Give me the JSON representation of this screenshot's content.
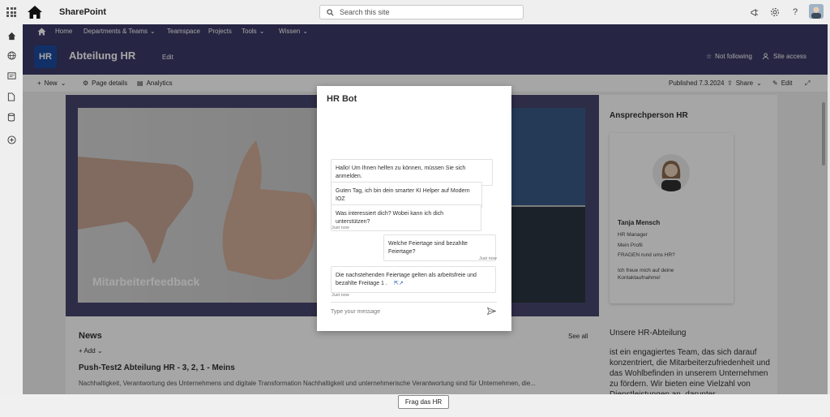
{
  "suite": {
    "app_title": "SharePoint",
    "search_placeholder": "Search this site"
  },
  "site_nav": {
    "items": [
      {
        "label": "Home",
        "dropdown": false
      },
      {
        "label": "Departments & Teams",
        "dropdown": true
      },
      {
        "label": "Teamspace",
        "dropdown": false
      },
      {
        "label": "Projects",
        "dropdown": false
      },
      {
        "label": "Tools",
        "dropdown": true
      },
      {
        "label": "Wissen",
        "dropdown": true
      }
    ]
  },
  "site_header": {
    "logo_text": "HR",
    "title": "Abteilung HR",
    "edit_label": "Edit",
    "follow_label": "Not following",
    "access_label": "Site access"
  },
  "command_bar": {
    "new_label": "New",
    "page_details_label": "Page details",
    "analytics_label": "Analytics",
    "published_label": "Published 7.3.2024",
    "share_label": "Share",
    "edit_label": "Edit"
  },
  "hero": {
    "caption": "Mitarbeiterfeedback"
  },
  "news": {
    "title": "News",
    "see_all": "See all",
    "add_label": "Add",
    "headline": "Push-Test2 Abteilung HR - 3, 2, 1 - Meins",
    "description": "Nachhaltigkeit, Verantwortung des Unternehmens und digitale Transformation Nachhaltigkeit und unternehmerische Verantwortung sind für Unternehmen, die..."
  },
  "contact": {
    "heading": "Ansprechperson HR",
    "name": "Tanja Mensch",
    "role": "HR Manager",
    "profile_line": "Mein Profil",
    "questions_line": "FRAGEN rund ums HR?",
    "note": "Ich freue mich auf deine Kontaktaufnahme!"
  },
  "hr_section": {
    "heading": "Unsere HR-Abteilung",
    "text": "ist ein engagiertes Team, das sich darauf konzentriert, die Mitarbeiterzufriedenheit und das Wohlbefinden in unserem Unternehmen zu fördern. Wir bieten eine Vielzahl von Dienstleistungen an, darunter"
  },
  "bottom": {
    "button_label": "Frag das HR"
  },
  "bot": {
    "title": "HR Bot",
    "messages": [
      {
        "from": "bot",
        "text": "Hallo! Um Ihnen helfen zu können, müssen Sie sich anmelden."
      },
      {
        "from": "bot",
        "text": "Guten Tag, ich bin dein smarter KI Helper auf Modern IOZ"
      },
      {
        "from": "bot",
        "text": "Was interessiert dich? Wobei kann ich dich unterstützen?"
      },
      {
        "from": "user",
        "text": "Welche Feiertage sind bezahlte Feiertage?"
      },
      {
        "from": "bot",
        "text": "Die nachstehenden Feiertage gelten als arbeitsfreie und bezahlte Freitage 1 ."
      }
    ],
    "timestamps": [
      "Just now",
      "Just now",
      "Just now"
    ],
    "input_placeholder": "Type your message"
  },
  "colors": {
    "suite_nav": "#3b3a67",
    "logo": "#1b4a9f",
    "hero_band": "#48466d"
  }
}
